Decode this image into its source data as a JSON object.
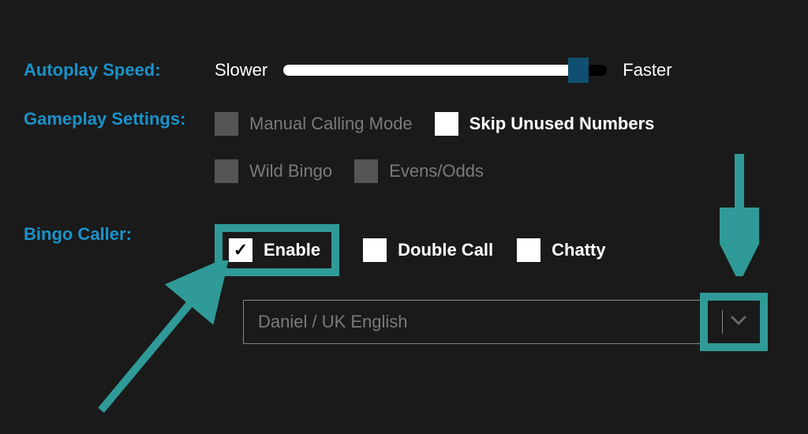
{
  "colors": {
    "accent": "#1b92c9",
    "highlight": "#2f9a97",
    "thumb": "#114f72"
  },
  "autoplay": {
    "label": "Autoplay Speed:",
    "slower": "Slower",
    "faster": "Faster",
    "value_pct": 90
  },
  "gameplay": {
    "label": "Gameplay Settings:",
    "manual": "Manual Calling Mode",
    "skip": "Skip Unused Numbers",
    "wild": "Wild Bingo",
    "evens": "Evens/Odds"
  },
  "caller": {
    "label": "Bingo Caller:",
    "enable": "Enable",
    "double": "Double Call",
    "chatty": "Chatty",
    "voice": "Daniel / UK English",
    "check_glyph": "✓"
  }
}
